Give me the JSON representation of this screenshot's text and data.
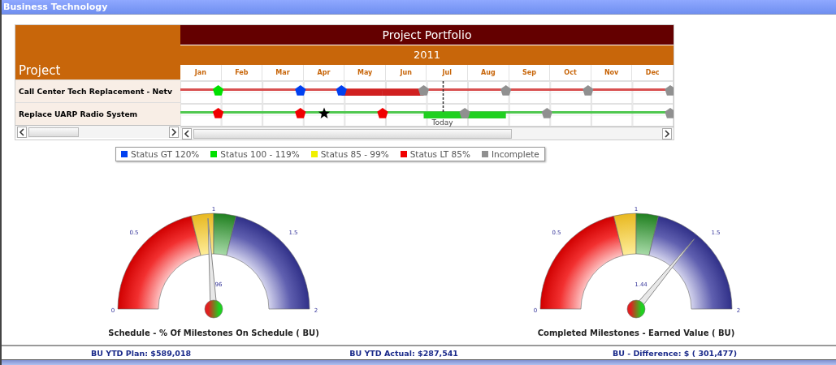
{
  "window": {
    "title": "Business Technology"
  },
  "portfolio": {
    "title": "Project Portfolio",
    "year": "2011",
    "project_header": "Project",
    "months": [
      "Jan",
      "Feb",
      "Mar",
      "Apr",
      "May",
      "Jun",
      "Jul",
      "Aug",
      "Sep",
      "Oct",
      "Nov",
      "Dec"
    ],
    "today_label": "Today",
    "projects": [
      {
        "name": "Call Center Tech Replacement - Netv",
        "color": "#d85050",
        "bar": {
          "color": "#d02020"
        },
        "slots": [
          {
            "kind": "pentagon",
            "color": "#00e000",
            "bar": false
          },
          {
            "kind": "none",
            "bar": false
          },
          {
            "kind": "pentagon",
            "color": "#0040f0",
            "bar": false
          },
          {
            "kind": "pentagon",
            "color": "#0040f0",
            "bar": false
          },
          {
            "kind": "none",
            "bar": true
          },
          {
            "kind": "pentagon",
            "color": "#909090",
            "bar": true
          },
          {
            "kind": "none",
            "bar": false
          },
          {
            "kind": "pentagon",
            "color": "#909090",
            "bar": false
          },
          {
            "kind": "none",
            "bar": false
          },
          {
            "kind": "pentagon",
            "color": "#909090",
            "bar": false
          },
          {
            "kind": "none",
            "bar": false
          },
          {
            "kind": "pentagon",
            "color": "#909090",
            "bar": false
          }
        ]
      },
      {
        "name": "Replace UARP Radio System",
        "color": "#50c850",
        "bar": {
          "color": "#20d020"
        },
        "slots": [
          {
            "kind": "pentagon",
            "color": "#f00000",
            "bar": false
          },
          {
            "kind": "none",
            "bar": false
          },
          {
            "kind": "pentagon",
            "color": "#f00000",
            "bar": false
          },
          {
            "kind": "star",
            "color": "#000000",
            "bar": false
          },
          {
            "kind": "pentagon",
            "color": "#f00000",
            "bar": false
          },
          {
            "kind": "none",
            "bar": false
          },
          {
            "kind": "pentagon",
            "color": "#909090",
            "bar": true
          },
          {
            "kind": "none",
            "bar": true
          },
          {
            "kind": "pentagon",
            "color": "#909090",
            "bar": false
          },
          {
            "kind": "none",
            "bar": false
          },
          {
            "kind": "none",
            "bar": false
          },
          {
            "kind": "pentagon",
            "color": "#909090",
            "bar": false
          }
        ]
      }
    ]
  },
  "legend": [
    {
      "label": "Status GT 120%",
      "color": "#0040f0"
    },
    {
      "label": "Status 100 - 119%",
      "color": "#00e000"
    },
    {
      "label": "Status 85 - 99%",
      "color": "#f0f000"
    },
    {
      "label": "Status LT 85%",
      "color": "#f00000"
    },
    {
      "label": "Incomplete",
      "color": "#909090"
    }
  ],
  "gauges": [
    {
      "title": "Schedule - % Of Milestones On Schedule ( BU)",
      "ticks": [
        "0",
        "0.5",
        "1",
        "1.5",
        "2"
      ],
      "reading": "96"
    },
    {
      "title": "Completed Milestones - Earned Value ( BU)",
      "ticks": [
        "0",
        "0.5",
        "1",
        "1.5",
        "2"
      ],
      "reading": "1.44"
    }
  ],
  "footer": [
    "BU YTD Plan: $589,018",
    "BU YTD Actual: $287,541",
    "BU - Difference: $ ( 301,477)"
  ]
}
